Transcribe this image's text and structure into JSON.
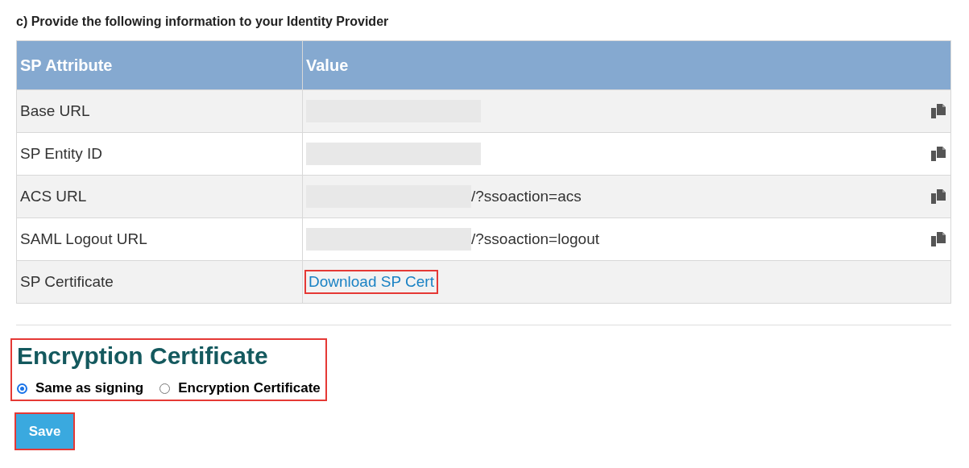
{
  "instruction": "c) Provide the following information to your Identity Provider",
  "table": {
    "columns": [
      "SP Attribute",
      "Value"
    ],
    "rows": [
      {
        "attribute": "Base URL",
        "value": {
          "kind": "redacted"
        },
        "copyable": true
      },
      {
        "attribute": "SP Entity ID",
        "value": {
          "kind": "redacted"
        },
        "copyable": true
      },
      {
        "attribute": "ACS URL",
        "value": {
          "kind": "redacted",
          "suffix": "/?ssoaction=acs"
        },
        "copyable": true
      },
      {
        "attribute": "SAML Logout URL",
        "value": {
          "kind": "redacted",
          "suffix": "/?ssoaction=logout"
        },
        "copyable": true
      },
      {
        "attribute": "SP Certificate",
        "value": {
          "kind": "link",
          "text": "Download SP Cert",
          "highlighted": true
        }
      }
    ]
  },
  "encryption": {
    "title": "Encryption Certificate",
    "highlighted": true,
    "options": [
      {
        "label": "Same as signing",
        "selected": true
      },
      {
        "label": "Encryption Certificate",
        "selected": false
      }
    ]
  },
  "save_button": {
    "label": "Save",
    "highlighted": true
  }
}
